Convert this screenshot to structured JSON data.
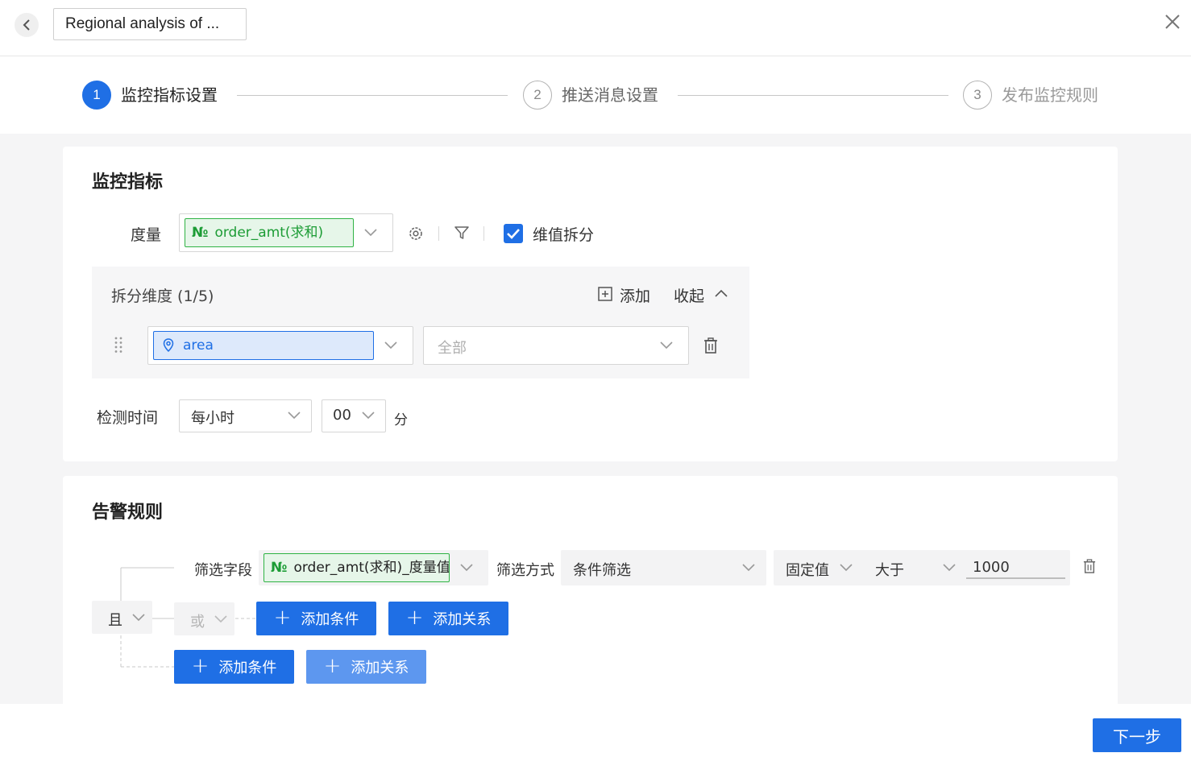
{
  "header": {
    "title": "Regional analysis of ..."
  },
  "steps": [
    {
      "number": "1",
      "label": "监控指标设置",
      "state": "active"
    },
    {
      "number": "2",
      "label": "推送消息设置",
      "state": "todo"
    },
    {
      "number": "3",
      "label": "发布监控规则",
      "state": "todo"
    }
  ],
  "monitor": {
    "section_title": "监控指标",
    "measure_label": "度量",
    "measure_icon": "№",
    "measure_value": "order_amt(求和)",
    "dim_split_label": "维值拆分",
    "dim_split_checked": true,
    "split_panel": {
      "title": "拆分维度 (1/5)",
      "add_label": "添加",
      "collapse_label": "收起",
      "dimension_value": "area",
      "filter_placeholder": "全部"
    },
    "detect_time_label": "检测时间",
    "frequency_value": "每小时",
    "minute_value": "00",
    "minute_unit": "分"
  },
  "alert": {
    "section_title": "告警规则",
    "filter_field_label": "筛选字段",
    "filter_field_icon": "№",
    "filter_field_value": "order_amt(求和)_度量值",
    "filter_method_label": "筛选方式",
    "filter_method_value": "条件筛选",
    "value_type": "固定值",
    "operator": "大于",
    "threshold": "1000",
    "relation_and": "且",
    "relation_or": "或",
    "add_condition_label": "添加条件",
    "add_relation_label": "添加关系"
  },
  "footer": {
    "next_label": "下一步"
  },
  "colors": {
    "primary": "#1f6fe5",
    "primary_light": "#5d97ef",
    "green": "#2fb344",
    "green_bg": "#e6f6e9",
    "blue_bg": "#dde9fb",
    "page_bg": "#f5f5f6"
  }
}
